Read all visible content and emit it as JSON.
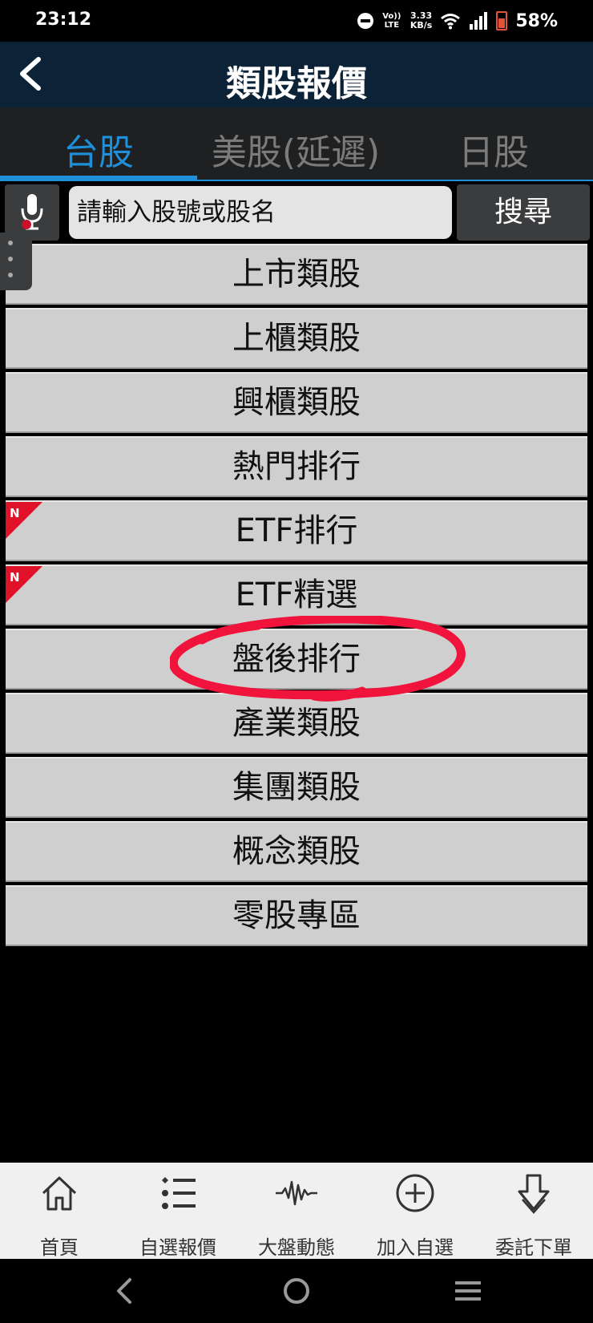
{
  "status_bar": {
    "time": "23:12",
    "volte": "Vo)) LTE",
    "speed_value": "3.33",
    "speed_unit": "KB/s",
    "battery": "58%"
  },
  "header": {
    "title": "類股報價",
    "back_icon": "chevron-left-icon"
  },
  "tabs": [
    {
      "label": "台股",
      "active": true
    },
    {
      "label": "美股(延遲)",
      "active": false
    },
    {
      "label": "日股",
      "active": false
    }
  ],
  "search": {
    "placeholder": "請輸入股號或股名",
    "button_label": "搜尋"
  },
  "menu": [
    {
      "label": "上市類股"
    },
    {
      "label": "上櫃類股"
    },
    {
      "label": "興櫃類股"
    },
    {
      "label": "熱門排行"
    },
    {
      "label": "ETF排行",
      "badge": "N"
    },
    {
      "label": "ETF精選",
      "badge": "N"
    },
    {
      "label": "盤後排行"
    },
    {
      "label": "產業類股"
    },
    {
      "label": "集團類股"
    },
    {
      "label": "概念類股"
    },
    {
      "label": "零股專區"
    }
  ],
  "bottom_nav": [
    {
      "label": "首頁",
      "icon": "home-icon"
    },
    {
      "label": "自選報價",
      "icon": "list-icon"
    },
    {
      "label": "大盤動態",
      "icon": "waveform-icon"
    },
    {
      "label": "加入自選",
      "icon": "plus-circle-icon"
    },
    {
      "label": "委託下單",
      "icon": "arrow-down-icon"
    }
  ],
  "colors": {
    "header_bg": "#0c2236",
    "tab_active": "#1e8fd8",
    "badge_red": "#e0122a",
    "annotation_red": "#f0143c"
  }
}
